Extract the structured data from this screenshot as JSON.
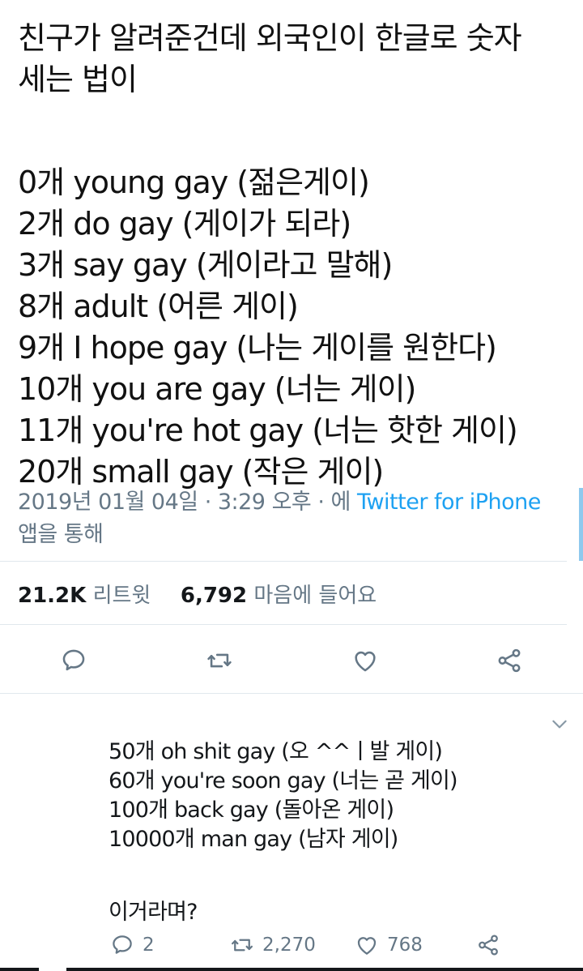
{
  "tweet": {
    "lines": [
      "친구가 알려준건데 외국인이 한글로 숫자",
      "세는 법이",
      "",
      "0개 young gay (젊은게이)",
      "2개 do gay (게이가 되라)",
      "3개 say gay (게이라고 말해)",
      "8개 adult (어른 게이)",
      "9개 I hope gay (나는 게이를 원한다)",
      "10개 you are gay (너는 게이)",
      "11개 you're hot gay (너는 핫한 게이)",
      "20개 small gay (작은 게이)"
    ],
    "timestamp": "2019년 01월 04일 · 3:29 오후 · 에",
    "source": "Twitter for iPhone",
    "source_suffix": "앱을 통해",
    "retweets_count": "21.2K",
    "retweets_label": "리트윗",
    "likes_count": "6,792",
    "likes_label": "마음에 들어요"
  },
  "actions": {
    "reply_icon": "speech-bubble-icon",
    "retweet_icon": "retweet-icon",
    "like_icon": "heart-icon",
    "share_icon": "share-icon"
  },
  "reply": {
    "lines": [
      "50개 oh shit gay (오 ^^ㅣ발 게이)",
      "60개 you're soon gay (너는 곧 게이)",
      "100개 back gay (돌아온 게이)",
      "10000개 man gay (남자 게이)",
      "",
      "이거라며?"
    ],
    "reply_count": "2",
    "retweet_count": "2,270",
    "like_count": "768"
  },
  "colors": {
    "link": "#1da1f2",
    "muted": "#657786",
    "text": "#14171a",
    "divider": "#e1e8ed"
  }
}
